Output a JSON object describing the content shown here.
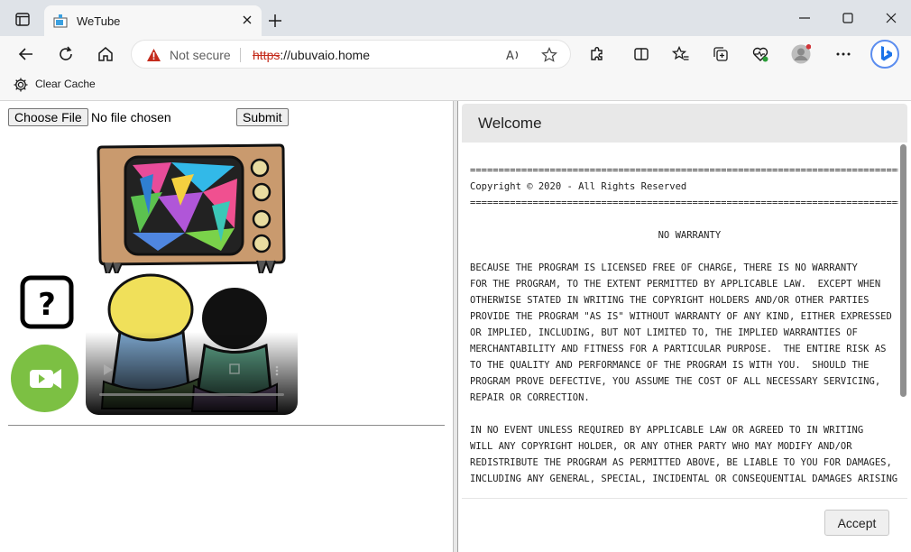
{
  "browser": {
    "tab_title": "WeTube",
    "address": {
      "security_label": "Not secure",
      "protocol": "https",
      "rest": "://ubuvaio.home"
    },
    "favorites": {
      "clear_cache_label": "Clear Cache"
    }
  },
  "page": {
    "file_button_label": "Choose File",
    "file_status": "No file chosen",
    "submit_label": "Submit"
  },
  "dialog": {
    "title": "Welcome",
    "license_text": "================================================================================\nCopyright © 2020 - All Rights Reserved\n================================================================================\n\n                                 NO WARRANTY\n\nBECAUSE THE PROGRAM IS LICENSED FREE OF CHARGE, THERE IS NO WARRANTY\nFOR THE PROGRAM, TO THE EXTENT PERMITTED BY APPLICABLE LAW.  EXCEPT WHEN\nOTHERWISE STATED IN WRITING THE COPYRIGHT HOLDERS AND/OR OTHER PARTIES\nPROVIDE THE PROGRAM \"AS IS\" WITHOUT WARRANTY OF ANY KIND, EITHER EXPRESSED\nOR IMPLIED, INCLUDING, BUT NOT LIMITED TO, THE IMPLIED WARRANTIES OF\nMERCHANTABILITY AND FITNESS FOR A PARTICULAR PURPOSE.  THE ENTIRE RISK AS\nTO THE QUALITY AND PERFORMANCE OF THE PROGRAM IS WITH YOU.  SHOULD THE\nPROGRAM PROVE DEFECTIVE, YOU ASSUME THE COST OF ALL NECESSARY SERVICING,\nREPAIR OR CORRECTION.\n\nIN NO EVENT UNLESS REQUIRED BY APPLICABLE LAW OR AGREED TO IN WRITING\nWILL ANY COPYRIGHT HOLDER, OR ANY OTHER PARTY WHO MAY MODIFY AND/OR\nREDISTRIBUTE THE PROGRAM AS PERMITTED ABOVE, BE LIABLE TO YOU FOR DAMAGES,\nINCLUDING ANY GENERAL, SPECIAL, INCIDENTAL OR CONSEQUENTIAL DAMAGES ARISING",
    "accept_label": "Accept"
  },
  "icons": {
    "tab_actions": "tab-actions-icon",
    "favicon": "wetube-favicon-icon",
    "tab_close": "close-icon",
    "new_tab": "plus-icon",
    "minimize": "minimize-icon",
    "maximize": "maximize-icon",
    "window_close": "close-icon",
    "back": "back-arrow-icon",
    "refresh": "refresh-icon",
    "home": "home-icon",
    "warning": "warning-icon",
    "read_aloud": "read-aloud-icon",
    "favorite": "star-icon",
    "extensions": "puzzle-icon",
    "split_screen": "split-screen-icon",
    "favorites": "favorites-icon",
    "collections": "collections-icon",
    "health": "browser-essentials-icon",
    "profile": "profile-avatar-icon",
    "more": "more-icon",
    "bing": "bing-icon",
    "gear": "gear-icon",
    "help": "question-mark-icon",
    "video": "video-camera-icon"
  },
  "colors": {
    "titlebar": "#dfe3e8",
    "toolbar": "#f7f7f7",
    "https_struck": "#c42b1c",
    "video_green": "#7cc043"
  }
}
